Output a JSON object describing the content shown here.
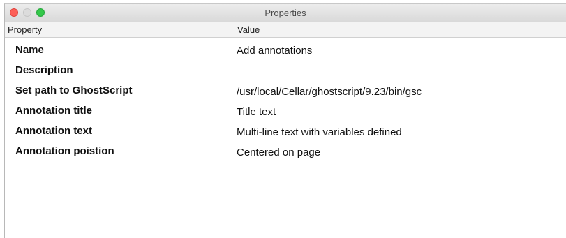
{
  "window": {
    "title": "Properties"
  },
  "columns": {
    "property": "Property",
    "value": "Value"
  },
  "rows": [
    {
      "property": "Name",
      "value": "Add annotations"
    },
    {
      "property": "Description",
      "value": ""
    },
    {
      "property": "Set path to GhostScript",
      "value": "/usr/local/Cellar/ghostscript/9.23/bin/gsc"
    },
    {
      "property": "Annotation title",
      "value": "Title text"
    },
    {
      "property": "Annotation text",
      "value": "Multi-line text with variables defined"
    },
    {
      "property": "Annotation poistion",
      "value": "Centered on page"
    }
  ],
  "colors": {
    "close": "#fd5f57",
    "minimize": "#dcdcdc",
    "zoom": "#34c84a",
    "header_bg": "#f3f3f3"
  }
}
